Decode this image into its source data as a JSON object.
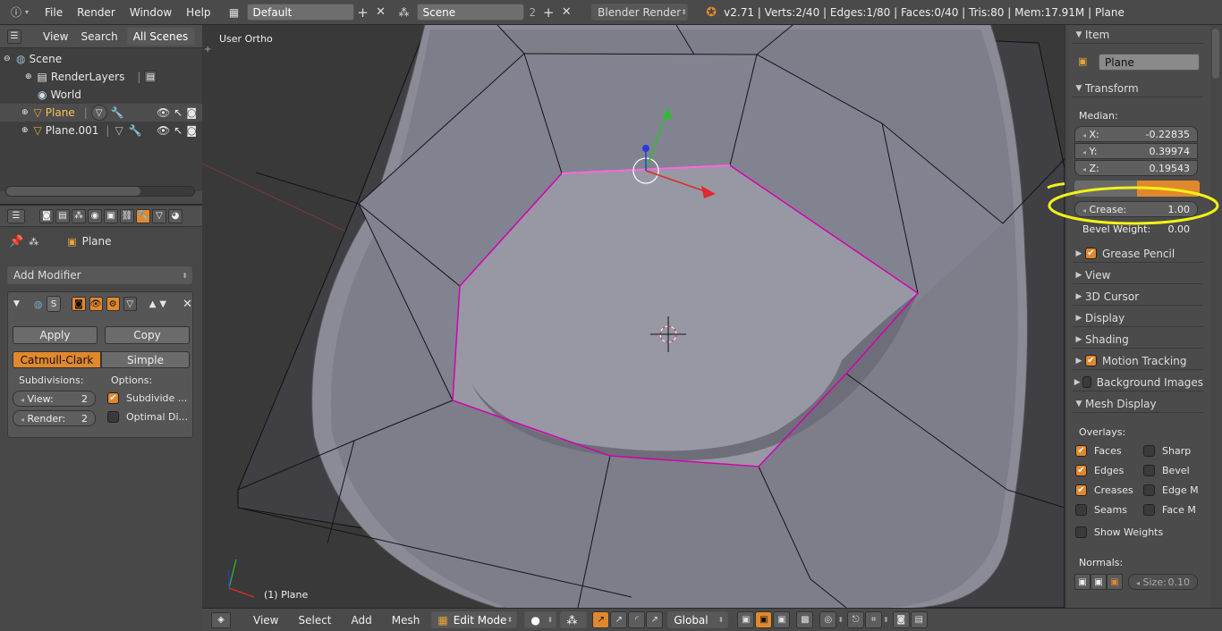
{
  "topbar": {
    "menus": [
      "File",
      "Render",
      "Window",
      "Help"
    ],
    "layout_name": "Default",
    "scene_name": "Scene",
    "scene_count": "2",
    "engine": "Blender Render",
    "stats": "v2.71 | Verts:2/40 | Edges:1/80 | Faces:0/40 | Tris:80 | Mem:17.91M | Plane"
  },
  "outliner": {
    "header": {
      "view": "View",
      "search": "Search",
      "scope": "All Scenes"
    },
    "items": [
      "Scene",
      "RenderLayers",
      "World",
      "Plane",
      "Plane.001"
    ]
  },
  "properties": {
    "object_name": "Plane",
    "add_modifier": "Add Modifier",
    "apply": "Apply",
    "copy": "Copy",
    "catmull": "Catmull-Clark",
    "simple": "Simple",
    "subdivisions_label": "Subdivisions:",
    "options_label": "Options:",
    "view_label": "View:",
    "view_value": "2",
    "render_label": "Render:",
    "render_value": "2",
    "subdivide_uvs": "Subdivide ...",
    "optimal_display": "Optimal Di..."
  },
  "viewport": {
    "view_name": "User Ortho",
    "object_label": "(1) Plane"
  },
  "npanel": {
    "item_title": "Item",
    "item_name": "Plane",
    "transform_title": "Transform",
    "median_label": "Median:",
    "x_label": "X:",
    "x_value": "-0.22835",
    "y_label": "Y:",
    "y_value": "0.39974",
    "z_label": "Z:",
    "z_value": "0.19543",
    "crease_label": "Crease:",
    "crease_value": "1.00",
    "bevel_label": "Bevel Weight:",
    "bevel_value": "0.00",
    "sections": [
      "Grease Pencil",
      "View",
      "3D Cursor",
      "Display",
      "Shading",
      "Motion Tracking",
      "Background Images",
      "Mesh Display"
    ],
    "overlays_label": "Overlays:",
    "faces": "Faces",
    "sharp": "Sharp",
    "edges": "Edges",
    "bevel": "Bevel",
    "creases": "Creases",
    "edge_m": "Edge M",
    "seams": "Seams",
    "face_m": "Face M",
    "show_weights": "Show Weights",
    "normals_label": "Normals:",
    "size_label": "Size:",
    "size_value": "0.10"
  },
  "bottombar": {
    "menus": [
      "View",
      "Select",
      "Add",
      "Mesh"
    ],
    "mode": "Edit Mode",
    "orientation": "Global"
  },
  "colors": {
    "accent": "#e1882d",
    "selection_edge": "#d400b0",
    "annotation": "#f2f218"
  }
}
